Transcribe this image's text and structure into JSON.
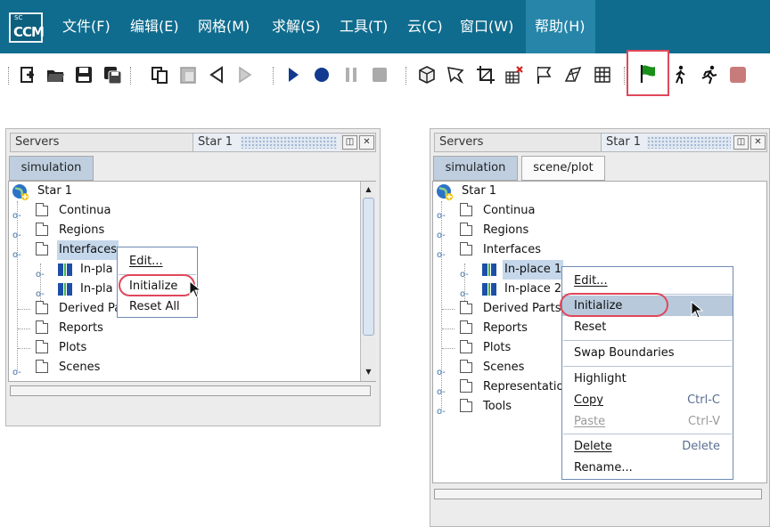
{
  "menubar": {
    "logo": {
      "small": "SC",
      "text": "CCM"
    },
    "items": [
      {
        "label": "文件(F)"
      },
      {
        "label": "编辑(E)"
      },
      {
        "label": "网格(M)"
      },
      {
        "label": "求解(S)"
      },
      {
        "label": "工具(T)"
      },
      {
        "label": "云(C)"
      },
      {
        "label": "窗口(W)"
      },
      {
        "label": "帮助(H)",
        "active": true
      }
    ]
  },
  "toolbar": {
    "icons": [
      "new-file-icon",
      "open-folder-icon",
      "save-icon",
      "save-all-icon",
      "copy-icon",
      "paste-icon",
      "step-back-icon",
      "step-forward-icon",
      "play-icon",
      "record-icon",
      "pause-icon",
      "stop-icon",
      "mesh-cube-icon",
      "filter-icon",
      "crop-icon",
      "grid-delete-icon",
      "flag-outline-icon",
      "surface-icon",
      "table-grid-icon",
      "initialize-flag-icon",
      "walk-icon",
      "run-icon",
      "stop-square-icon"
    ],
    "highlight": "initialize-flag-icon",
    "accent": "#1a8f1a"
  },
  "colors": {
    "menubar": "#0f6c8e",
    "menubar_active": "#2685a8",
    "highlight_ring": "#e0475a",
    "selection": "#c5d7ea"
  },
  "left_panel": {
    "tab_servers": "Servers",
    "tab_star": "Star 1",
    "sub_tabs": [
      "simulation"
    ],
    "tree_root": "Star 1",
    "tree": [
      "Continua",
      "Regions",
      "Interfaces",
      "In-pla",
      "In-pla",
      "Derived Pa",
      "Reports",
      "Plots",
      "Scenes"
    ],
    "context_menu": [
      {
        "label": "Edit...",
        "underline": "E"
      },
      {
        "label": "Initialize",
        "highlighted": true
      },
      {
        "label": "Reset All"
      }
    ]
  },
  "right_panel": {
    "tab_servers": "Servers",
    "tab_star": "Star 1",
    "sub_tabs": [
      "simulation",
      "scene/plot"
    ],
    "tree_root": "Star 1",
    "tree": [
      "Continua",
      "Regions",
      "Interfaces",
      "In-place 1",
      "In-place 2",
      "Derived Parts",
      "Reports",
      "Plots",
      "Scenes",
      "Representatio",
      "Tools"
    ],
    "context_menu": [
      {
        "label": "Edit...",
        "underline": "E"
      },
      {
        "label": "Initialize",
        "highlighted": true
      },
      {
        "label": "Reset"
      },
      {
        "label": "Swap Boundaries"
      },
      {
        "label": "Highlight"
      },
      {
        "label": "Copy",
        "shortcut": "Ctrl-C",
        "underline": "C"
      },
      {
        "label": "Paste",
        "shortcut": "Ctrl-V",
        "disabled": true,
        "underline": "P"
      },
      {
        "label": "Delete",
        "shortcut": "Delete",
        "underline": "D"
      },
      {
        "label": "Rename..."
      }
    ]
  }
}
